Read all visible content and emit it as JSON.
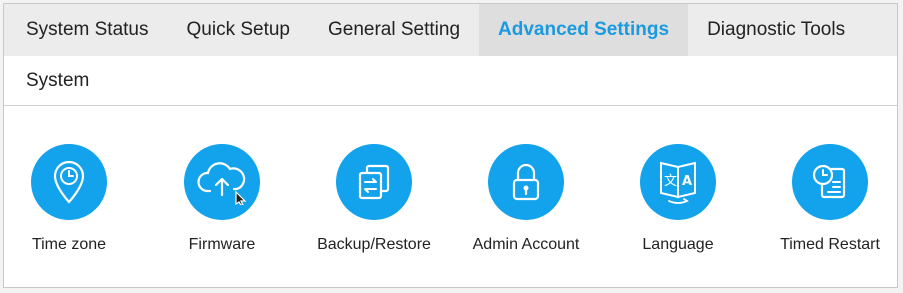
{
  "tabs": [
    {
      "label": "System Status"
    },
    {
      "label": "Quick Setup"
    },
    {
      "label": "General Setting"
    },
    {
      "label": "Advanced Settings",
      "active": true
    },
    {
      "label": "Diagnostic Tools"
    }
  ],
  "section": {
    "title": "System"
  },
  "items": [
    {
      "label": "Time zone",
      "icon": "location-clock-icon"
    },
    {
      "label": "Firmware",
      "icon": "cloud-upload-icon"
    },
    {
      "label": "Backup/Restore",
      "icon": "backup-restore-icon"
    },
    {
      "label": "Admin Account",
      "icon": "lock-icon"
    },
    {
      "label": "Language",
      "icon": "language-book-icon"
    },
    {
      "label": "Timed Restart",
      "icon": "clock-document-icon"
    }
  ],
  "colors": {
    "accent": "#12a3ec",
    "active_tab_text": "#1a9ae0",
    "tab_bar": "#ececec"
  }
}
